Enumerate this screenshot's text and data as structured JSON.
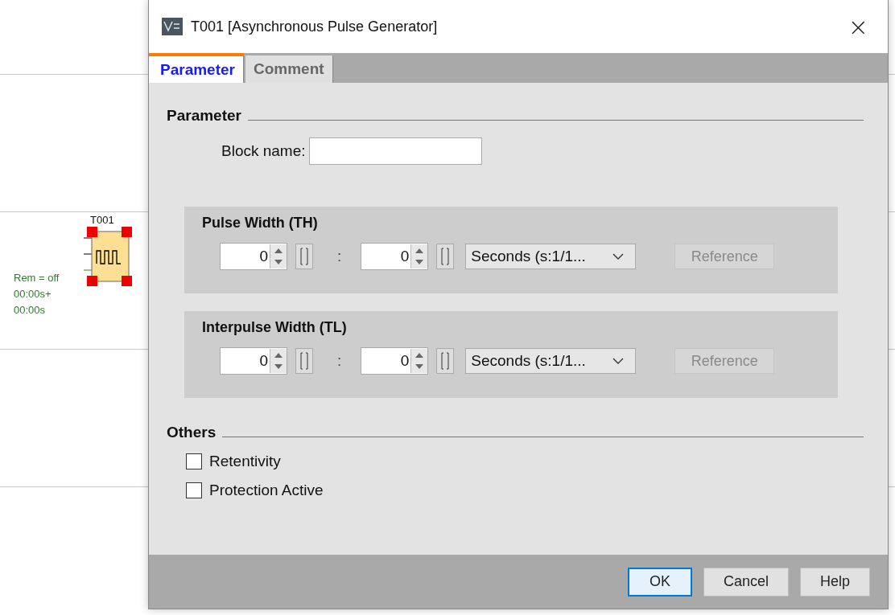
{
  "canvas": {
    "block": {
      "label": "T001",
      "remanence": "Rem = off",
      "time_high": "00:00s+",
      "time_low": "00:00s"
    }
  },
  "dialog": {
    "title": "T001 [Asynchronous Pulse Generator]",
    "close": "×",
    "tabs": [
      {
        "label": "Parameter",
        "selected": true
      },
      {
        "label": "Comment",
        "selected": false
      }
    ],
    "parameter": {
      "heading": "Parameter",
      "block_name_label": "Block name:"
    },
    "groups": [
      {
        "title": "Pulse Width (TH)",
        "first_value": "0",
        "separator": ":",
        "second_value": "0",
        "unit": "Seconds (s:1/1...",
        "reference": "Reference",
        "reference_disabled": true
      },
      {
        "title": "Interpulse Width (TL)",
        "first_value": "0",
        "separator": ":",
        "second_value": "0",
        "unit": "Seconds (s:1/1...",
        "reference": "Reference",
        "reference_disabled": true
      }
    ],
    "others": {
      "heading": "Others",
      "options": [
        {
          "label": "Retentivity",
          "checked": false
        },
        {
          "label": "Protection Active",
          "checked": false
        }
      ]
    },
    "buttons": [
      {
        "label": "OK",
        "default": true
      },
      {
        "label": "Cancel",
        "default": false
      },
      {
        "label": "Help",
        "default": false
      }
    ]
  }
}
